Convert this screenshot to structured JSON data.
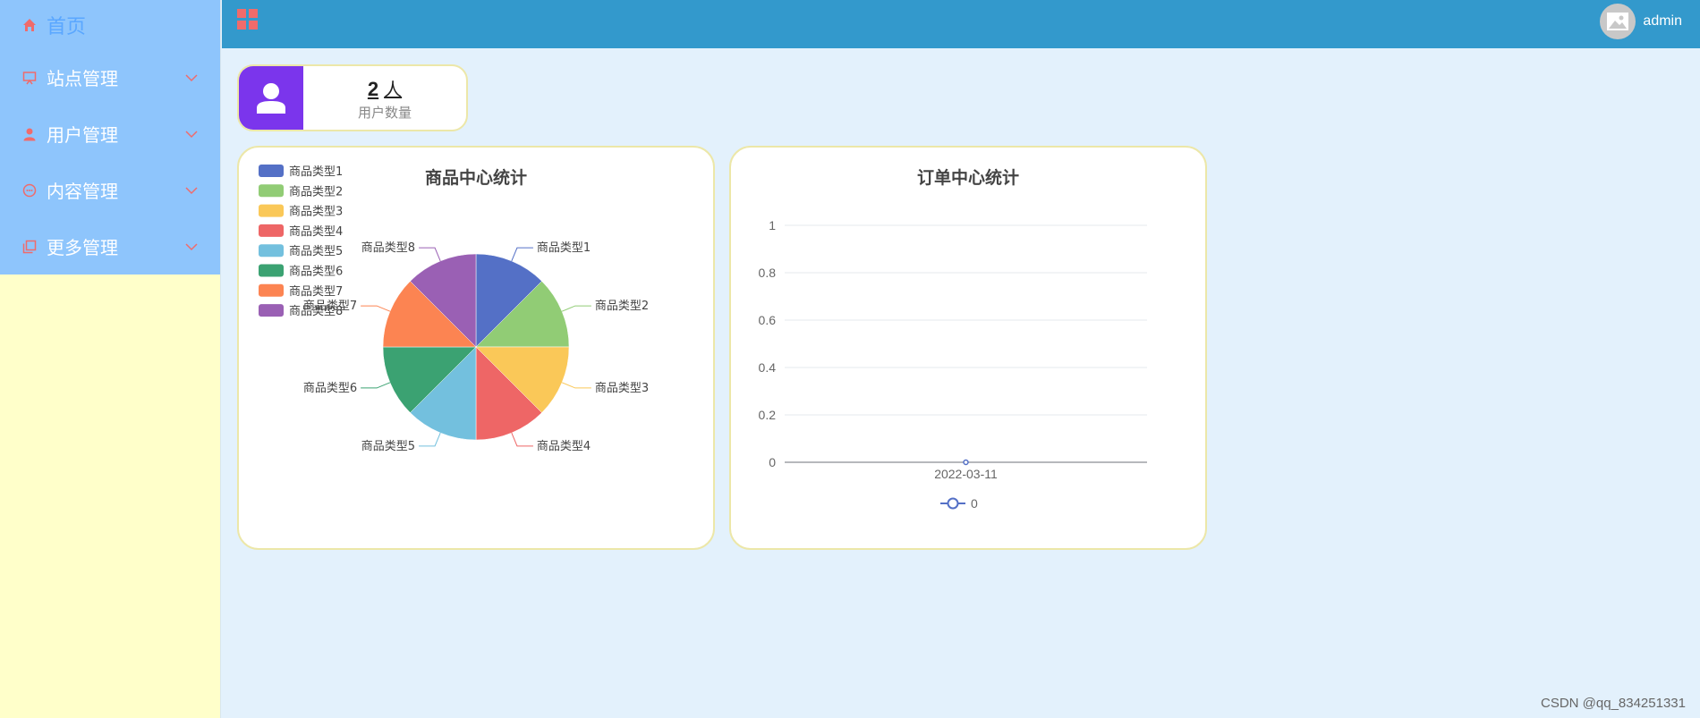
{
  "sidebar": {
    "items": [
      {
        "label": "首页",
        "icon": "home-icon"
      },
      {
        "label": "站点管理",
        "icon": "site-icon"
      },
      {
        "label": "用户管理",
        "icon": "user-icon"
      },
      {
        "label": "内容管理",
        "icon": "message-icon"
      },
      {
        "label": "更多管理",
        "icon": "copy-icon"
      }
    ]
  },
  "header": {
    "user_name": "admin",
    "icon_color": "#f06b6b"
  },
  "stat": {
    "value": "2",
    "unit": "人",
    "label": "用户数量",
    "icon_color": "#7b35ec"
  },
  "chart_data": [
    {
      "type": "pie",
      "title": "商品中心统计",
      "categories": [
        "商品类型1",
        "商品类型2",
        "商品类型3",
        "商品类型4",
        "商品类型5",
        "商品类型6",
        "商品类型7",
        "商品类型8"
      ],
      "values": [
        1,
        1,
        1,
        1,
        1,
        1,
        1,
        1
      ],
      "colors": [
        "#5470c6",
        "#91cc75",
        "#fac858",
        "#ee6666",
        "#73c0de",
        "#3ba272",
        "#fc8452",
        "#9a60b4"
      ],
      "legend_placement": "top-left"
    },
    {
      "type": "line",
      "title": "订单中心统计",
      "x": [
        "2022-03-11"
      ],
      "series": [
        {
          "name": "0",
          "values": [
            0
          ]
        }
      ],
      "ylim": [
        0,
        1
      ],
      "yticks": [
        "0",
        "0.2",
        "0.4",
        "0.6",
        "0.8",
        "1"
      ],
      "grid": true,
      "legend_placement": "bottom",
      "color": "#5470c6"
    }
  ],
  "watermark": "CSDN @qq_834251331"
}
